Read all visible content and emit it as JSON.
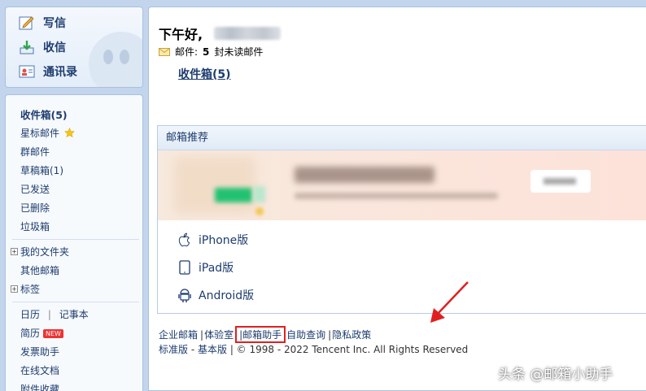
{
  "quick_actions": {
    "compose": "写信",
    "receive": "收信",
    "contacts": "通讯录"
  },
  "sidebar": {
    "folders": [
      {
        "label": "收件箱(5)",
        "bold": true
      },
      {
        "label": "星标邮件"
      },
      {
        "label": "群邮件"
      },
      {
        "label": "草稿箱(1)"
      },
      {
        "label": "已发送"
      },
      {
        "label": "已删除"
      },
      {
        "label": "垃圾箱"
      }
    ],
    "groups": [
      {
        "label": "我的文件夹"
      },
      {
        "label": "其他邮箱"
      },
      {
        "label": "标签"
      }
    ],
    "apps": {
      "calendar": "日历",
      "notes": "记事本",
      "resume": "简历",
      "resume_badge": "NEW",
      "invoice": "发票助手",
      "docs": "在线文档",
      "attachments": "附件收藏"
    }
  },
  "main": {
    "greeting": "下午好,",
    "mail_label": "邮件:",
    "unread_count": "5",
    "unread_text": "封未读邮件",
    "inbox_link": "收件箱(5)",
    "recommend_title": "邮箱推荐",
    "platforms": [
      "iPhone版",
      "iPad版",
      "Android版"
    ]
  },
  "footer": {
    "links": [
      "企业邮箱",
      "体验室",
      "邮箱助手",
      "自助查询",
      "隐私政策"
    ],
    "highlighted": "邮箱助手",
    "standard": "标准版",
    "dash": " - ",
    "basic": "基本版",
    "copyright": " | © 1998 - 2022 Tencent Inc. All Rights Reserved"
  },
  "watermark": "头条 @邮箱小助手",
  "colors": {
    "link": "#1d3c6e",
    "background": "#c2d5ec",
    "annotation": "#e02020",
    "star": "#f5c518"
  }
}
